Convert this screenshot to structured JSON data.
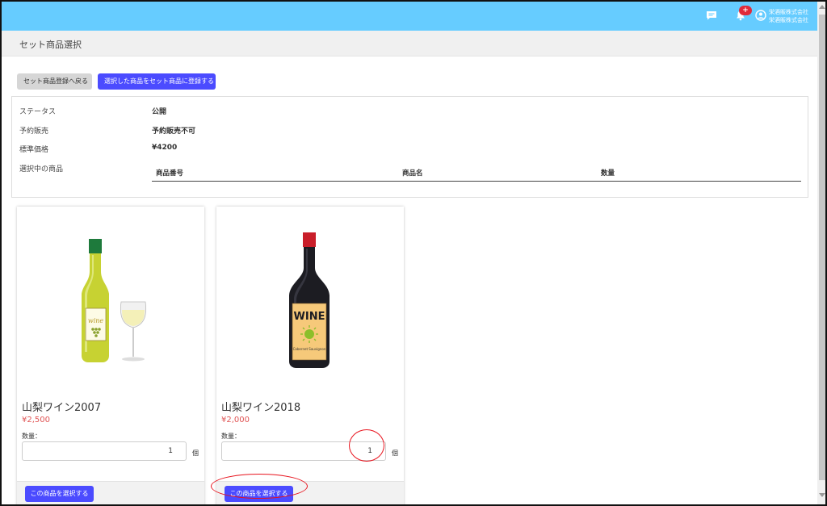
{
  "header": {
    "notification_count": "+",
    "company_line1": "栄酒販株式会社",
    "company_line2": "栄酒販株式会社",
    "icons": [
      "chat-icon",
      "bell-icon",
      "user-circle-icon"
    ],
    "bg_color": "#66ccff"
  },
  "page": {
    "title": "セット商品選択"
  },
  "actions": {
    "back_label": "セット商品登録へ戻る",
    "register_label": "選択した商品をセット商品に登録する"
  },
  "info": {
    "status_label": "ステータス",
    "status_value": "公開",
    "preorder_label": "予約販売",
    "preorder_value": "予約販売不可",
    "price_label": "標準価格",
    "price_value": "¥4200",
    "selected_label": "選択中の商品",
    "columns": [
      "商品番号",
      "商品名",
      "数量"
    ]
  },
  "products": [
    {
      "name": "山梨ワイン2007",
      "price": "¥2,500",
      "qty_label": "数量：",
      "qty": "1",
      "unit": "個",
      "select_label": "この商品を選択する",
      "image": "white-wine-bottle-and-glass",
      "label_text": "wine"
    },
    {
      "name": "山梨ワイン2018",
      "price": "¥2,000",
      "qty_label": "数量：",
      "qty": "1",
      "unit": "個",
      "select_label": "この商品を選択する",
      "image": "red-wine-bottle",
      "label_text": "WINE",
      "label_subtext": "Cabernet Sauvignon"
    }
  ],
  "colors": {
    "accent": "#4b4bff",
    "price": "#e05555",
    "annotation": "#e8141e"
  }
}
